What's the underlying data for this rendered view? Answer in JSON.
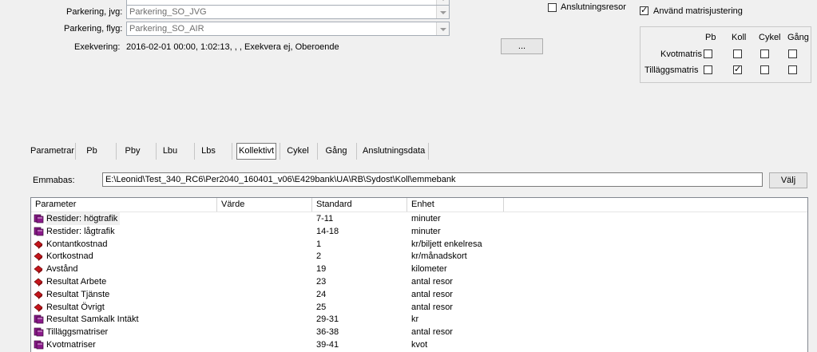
{
  "top": {
    "parking_jvg": {
      "label": "Parkering, jvg:",
      "value": "Parkering_SO_JVG"
    },
    "parking_air": {
      "label": "Parkering, flyg:",
      "value": "Parkering_SO_AIR"
    },
    "execution": {
      "label": "Exekvering:",
      "value": "2016-02-01 00:00, 1:02:13, , , Exekvera ej, Oberoende"
    },
    "ellipsis_button": "...",
    "connection_trips": {
      "label": "Anslutningsresor",
      "checked": false
    },
    "use_matrix_adjust": {
      "label": "Använd matrisjustering",
      "checked": true
    }
  },
  "matrix_grid": {
    "columns": [
      "Pb",
      "Koll",
      "Cykel",
      "Gång"
    ],
    "rows": [
      {
        "label": "Kvotmatris",
        "checks": [
          false,
          false,
          false,
          false
        ]
      },
      {
        "label": "Tilläggsmatris",
        "checks": [
          false,
          true,
          false,
          false
        ]
      }
    ]
  },
  "tabs": [
    {
      "label": "Parametrar",
      "active": false
    },
    {
      "label": "Pb",
      "active": false
    },
    {
      "label": "Pby",
      "active": false
    },
    {
      "label": "Lbu",
      "active": false
    },
    {
      "label": "Lbs",
      "active": false
    },
    {
      "label": "Kollektivt",
      "active": true
    },
    {
      "label": "Cykel",
      "active": false
    },
    {
      "label": "Gång",
      "active": false
    },
    {
      "label": "Anslutningsdata",
      "active": false
    }
  ],
  "emmabas": {
    "label": "Emmabas:",
    "value": "E:\\Leonid\\Test_340_RC6\\Per2040_160401_v06\\E429bank\\UA\\RB\\Sydost\\Koll\\emmebank",
    "button": "Välj"
  },
  "table": {
    "headers": [
      "Parameter",
      "Värde",
      "Standard",
      "Enhet"
    ],
    "rows": [
      {
        "icon": "books-icon",
        "parameter": "Restider: högtrafik",
        "value": "",
        "standard": "7-11",
        "unit": "minuter"
      },
      {
        "icon": "books-icon",
        "parameter": "Restider: lågtrafik",
        "value": "",
        "standard": "14-18",
        "unit": "minuter"
      },
      {
        "icon": "diamond-icon",
        "parameter": "Kontantkostnad",
        "value": "",
        "standard": "1",
        "unit": "kr/biljett enkelresa"
      },
      {
        "icon": "diamond-icon",
        "parameter": "Kortkostnad",
        "value": "",
        "standard": "2",
        "unit": "kr/månadskort"
      },
      {
        "icon": "diamond-icon",
        "parameter": "Avstånd",
        "value": "",
        "standard": "19",
        "unit": "kilometer"
      },
      {
        "icon": "diamond-icon",
        "parameter": "Resultat Arbete",
        "value": "",
        "standard": "23",
        "unit": "antal resor"
      },
      {
        "icon": "diamond-icon",
        "parameter": "Resultat Tjänste",
        "value": "",
        "standard": "24",
        "unit": "antal resor"
      },
      {
        "icon": "diamond-icon",
        "parameter": "Resultat Övrigt",
        "value": "",
        "standard": "25",
        "unit": "antal resor"
      },
      {
        "icon": "books-icon",
        "parameter": "Resultat Samkalk Intäkt",
        "value": "",
        "standard": "29-31",
        "unit": "kr"
      },
      {
        "icon": "books-icon",
        "parameter": "Tilläggsmatriser",
        "value": "",
        "standard": "36-38",
        "unit": "antal resor"
      },
      {
        "icon": "books-icon",
        "parameter": "Kvotmatriser",
        "value": "",
        "standard": "39-41",
        "unit": "kvot"
      }
    ]
  },
  "colors": {
    "book_purple": "#8b1a8b",
    "book_red": "#c4151c",
    "window_bg": "#f0f0f0"
  }
}
